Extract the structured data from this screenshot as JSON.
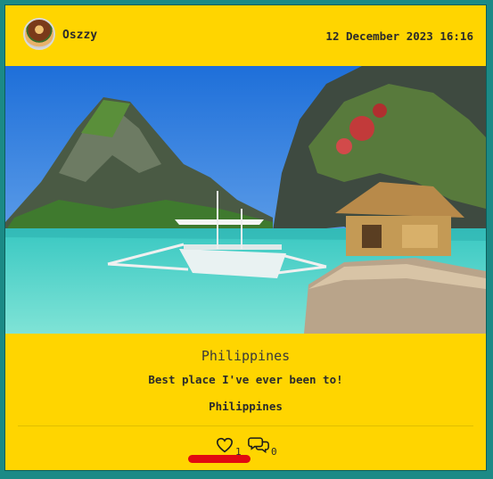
{
  "post": {
    "username": "Oszzy",
    "datetime": "12 December 2023 16:16",
    "title": "Philippines",
    "description": "Best place I've ever been to!",
    "location": "Philippines",
    "likes": "1",
    "comments": "0"
  },
  "icons": {
    "avatar": "burger-avatar",
    "like": "heart-icon",
    "comment": "comment-bubbles-icon"
  },
  "colors": {
    "card_background": "#ffd500",
    "page_background": "#1b8a86",
    "highlight": "#e10a10"
  }
}
